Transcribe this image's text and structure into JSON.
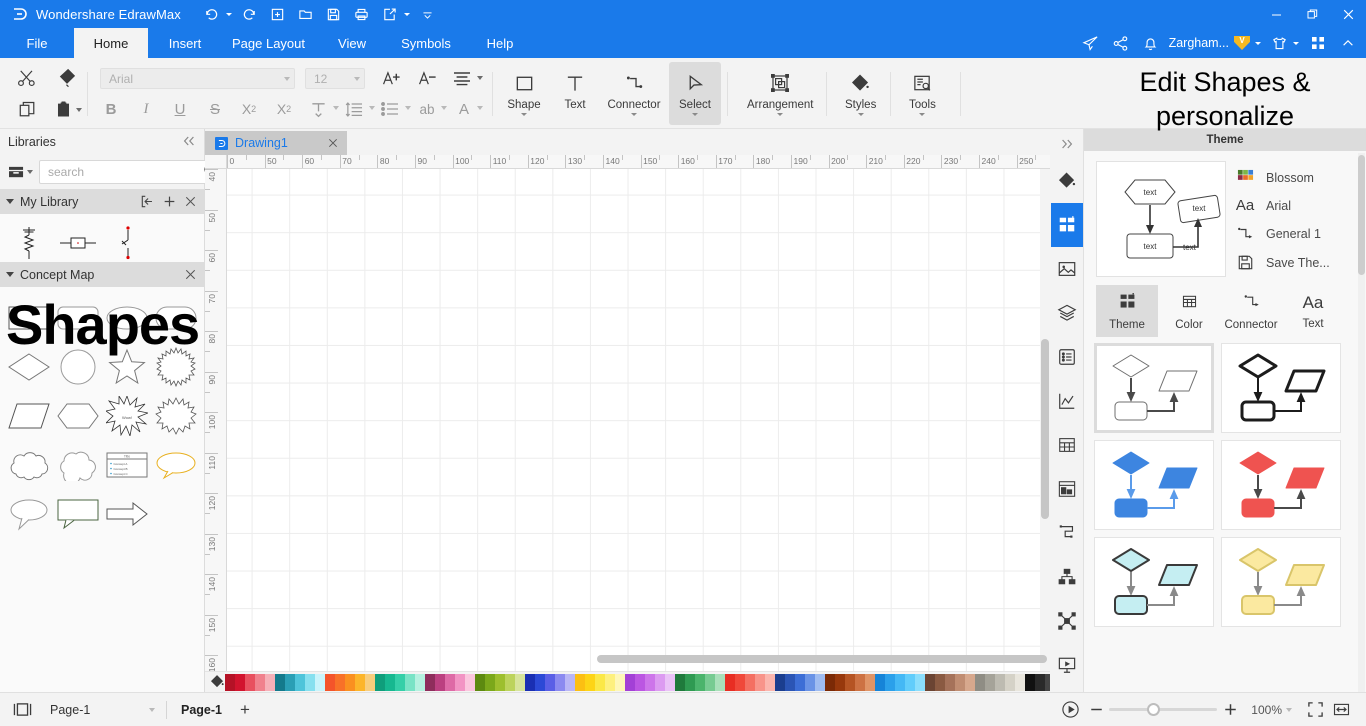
{
  "titlebar": {
    "app_name": "Wondershare EdrawMax",
    "logo_icon": "edraw-logo-icon",
    "quick_access": [
      {
        "name": "undo",
        "icon": "undo-icon",
        "has_caret": true
      },
      {
        "name": "redo",
        "icon": "redo-icon",
        "has_caret": false
      },
      {
        "name": "new",
        "icon": "new-file-icon",
        "has_caret": false
      },
      {
        "name": "open",
        "icon": "open-folder-icon",
        "has_caret": false
      },
      {
        "name": "save",
        "icon": "save-disk-icon",
        "has_caret": false
      },
      {
        "name": "print",
        "icon": "print-icon",
        "has_caret": false
      },
      {
        "name": "export",
        "icon": "export-share-icon",
        "has_caret": true
      },
      {
        "name": "customize",
        "icon": "chevron-down-icon",
        "has_caret": false
      }
    ],
    "window_controls": [
      {
        "name": "minimize",
        "glyph": "─"
      },
      {
        "name": "restore",
        "glyph": "❐"
      },
      {
        "name": "close",
        "glyph": "✕"
      }
    ]
  },
  "menubar": {
    "tabs": [
      {
        "label": "File",
        "active": false
      },
      {
        "label": "Home",
        "active": true
      },
      {
        "label": "Insert",
        "active": false
      },
      {
        "label": "Page Layout",
        "active": false
      },
      {
        "label": "View",
        "active": false
      },
      {
        "label": "Symbols",
        "active": false
      },
      {
        "label": "Help",
        "active": false
      }
    ],
    "right_icons": [
      {
        "name": "send-feedback-icon"
      },
      {
        "name": "share-icon"
      },
      {
        "name": "notifications-bell-icon"
      }
    ],
    "user": {
      "name": "Zargham...",
      "badge": "V"
    },
    "theme_switch_icon": "shirt-theme-icon",
    "apps_grid_icon": "apps-grid-icon",
    "collapse_ribbon_icon": "chevron-up-icon"
  },
  "ribbon": {
    "clipboard": [
      {
        "name": "cut",
        "icon": "scissors-icon",
        "disabled": false
      },
      {
        "name": "format-painter",
        "icon": "format-painter-icon",
        "disabled": false
      },
      {
        "name": "copy",
        "icon": "copy-icon",
        "disabled": false
      },
      {
        "name": "paste",
        "icon": "paste-icon",
        "disabled": false,
        "has_caret": true
      }
    ],
    "font_name": {
      "value": "Arial",
      "disabled": true
    },
    "font_size": {
      "value": "12",
      "disabled": true
    },
    "font_tools_row1": [
      {
        "name": "increase-font-size",
        "icon": "increase-font-icon"
      },
      {
        "name": "decrease-font-size",
        "icon": "decrease-font-icon"
      },
      {
        "name": "align-text",
        "icon": "align-icon",
        "has_caret": true
      }
    ],
    "font_tools_row2": [
      {
        "name": "bold",
        "icon": "bold-icon",
        "glyph": "B"
      },
      {
        "name": "italic",
        "icon": "italic-icon",
        "glyph": "I"
      },
      {
        "name": "underline",
        "icon": "underline-icon",
        "glyph": "U"
      },
      {
        "name": "strikethrough",
        "icon": "strikethrough-icon",
        "glyph": "S"
      },
      {
        "name": "superscript",
        "icon": "superscript-icon"
      },
      {
        "name": "subscript",
        "icon": "subscript-icon"
      },
      {
        "name": "text-position",
        "icon": "text-position-icon",
        "has_caret": true
      },
      {
        "name": "line-spacing",
        "icon": "line-spacing-icon",
        "has_caret": true
      },
      {
        "name": "bullet-list",
        "icon": "bullet-list-icon",
        "has_caret": true
      },
      {
        "name": "text-wrap",
        "icon": "text-wrap-icon",
        "glyph": "ab",
        "has_caret": true
      },
      {
        "name": "font-color",
        "icon": "font-color-icon",
        "glyph": "A",
        "has_caret": true
      }
    ],
    "big_buttons": [
      {
        "label": "Shape",
        "icon": "shape-square-icon",
        "has_caret": true,
        "active": false
      },
      {
        "label": "Text",
        "icon": "text-t-icon",
        "has_caret": false,
        "active": false
      },
      {
        "label": "Connector",
        "icon": "connector-icon",
        "has_caret": true,
        "active": false
      },
      {
        "label": "Select",
        "icon": "select-cursor-icon",
        "has_caret": true,
        "active": true
      },
      {
        "label": "Arrangement",
        "icon": "arrangement-icon",
        "has_caret": true,
        "active": false
      },
      {
        "label": "Styles",
        "icon": "fill-bucket-icon",
        "has_caret": true,
        "active": false
      },
      {
        "label": "Tools",
        "icon": "tools-inspect-icon",
        "has_caret": true,
        "active": false
      }
    ]
  },
  "libraries": {
    "title": "Libraries",
    "collapse_icon": "double-chevron-left-icon",
    "library_dropdown_icon": "library-box-icon",
    "search": {
      "placeholder": "search",
      "value": "",
      "icon": "search-icon"
    },
    "nav_up_icon": "chevron-up-icon",
    "nav_down_icon": "chevron-down-icon",
    "groups": [
      {
        "name": "My Library",
        "expanded": true,
        "actions": [
          {
            "name": "import-library",
            "icon": "import-icon"
          },
          {
            "name": "add-library",
            "icon": "plus-icon"
          },
          {
            "name": "close-library",
            "icon": "close-x-icon"
          }
        ],
        "shapes": [
          "resistor-symbol",
          "box-inline-symbol",
          "switch-symbol"
        ]
      },
      {
        "name": "Concept Map",
        "expanded": true,
        "actions": [
          {
            "name": "close-library",
            "icon": "close-x-icon"
          }
        ],
        "shapes": [
          "rectangle",
          "rounded-rectangle",
          "ellipse-flat",
          "stadium",
          "diamond",
          "circle",
          "star-5",
          "starburst-many",
          "parallelogram",
          "hexagon",
          "explosion-1",
          "explosion-2",
          "cloud-bumpy",
          "cloud-smooth",
          "list-card",
          "speech-oval",
          "speech-oval-tail",
          "speech-rect-tail",
          "block-arrow"
        ]
      }
    ],
    "overlay_text": "Shapes"
  },
  "canvas": {
    "tab": {
      "label": "Drawing1",
      "icon": "edraw-doc-icon",
      "close_icon": "close-x-icon"
    },
    "ruler_h_labels": [
      "0",
      "50",
      "60",
      "70",
      "80",
      "90",
      "100",
      "110",
      "120",
      "130",
      "140",
      "150",
      "160",
      "170",
      "180",
      "190",
      "200",
      "210",
      "220",
      "230",
      "240",
      "250"
    ],
    "ruler_v_labels": [
      "40",
      "50",
      "60",
      "70",
      "80",
      "90",
      "100",
      "110",
      "120",
      "130",
      "140",
      "150",
      "160"
    ],
    "vscroll_name": "canvas-vertical-scrollbar",
    "hscroll_name": "canvas-horizontal-scrollbar"
  },
  "palette": {
    "fill_icon": "fill-bucket-icon",
    "colors": [
      "#b51226",
      "#d2142e",
      "#e8505f",
      "#f0818d",
      "#f6b0b8",
      "#147a8c",
      "#2a9fb5",
      "#4ec4da",
      "#87e0ef",
      "#c9f4fb",
      "#f4542a",
      "#f87128",
      "#fa9020",
      "#fcb52a",
      "#f8cd7c",
      "#0f9e7b",
      "#17b890",
      "#35cfa8",
      "#79e3c6",
      "#b5f1e0",
      "#8e2d5c",
      "#bb4080",
      "#de6aa6",
      "#f294c4",
      "#fbc6de",
      "#5d8a10",
      "#7ba81b",
      "#9dbf2e",
      "#bcd35c",
      "#d7e49b",
      "#1a2fb3",
      "#2c49d6",
      "#5a5fe6",
      "#8b8af0",
      "#b9b6f6",
      "#fcbf12",
      "#fdd416",
      "#fbe847",
      "#fdf07e",
      "#fef7b8",
      "#a340d6",
      "#bb56e2",
      "#cd75ea",
      "#dc9bf1",
      "#eac2f7",
      "#1f7a3c",
      "#2f9a52",
      "#4bb46c",
      "#77cb92",
      "#a9e0ba",
      "#e82e23",
      "#f0483a",
      "#f46f62",
      "#f8948a",
      "#fbb5ad",
      "#1b3e8f",
      "#2b55b5",
      "#3d6ed6",
      "#6a93e6",
      "#9fbcf1",
      "#7b2a06",
      "#97380c",
      "#b55423",
      "#cd7243",
      "#e09466",
      "#1684d8",
      "#2ba0ea",
      "#44b8f5",
      "#62cdfb",
      "#8bdefc",
      "#6b4433",
      "#8a5a42",
      "#a5725a",
      "#c08d72",
      "#d7a88d",
      "#8f8d84",
      "#a5a399",
      "#bdbbb1",
      "#d5d2c7",
      "#e9e6dd",
      "#111111",
      "#2a2a2a",
      "#454545",
      "#636363",
      "#828282",
      "#a0a0a0",
      "#bdbdbd",
      "#d6d6d6",
      "#ededed",
      "#ffffff"
    ]
  },
  "rail": {
    "expand_icon": "double-chevron-right-icon",
    "items": [
      {
        "name": "styles-fill-icon",
        "active": false
      },
      {
        "name": "theme-grid-icon",
        "active": true
      },
      {
        "name": "image-icon",
        "active": false
      },
      {
        "name": "layers-icon",
        "active": false
      },
      {
        "name": "outline-list-icon",
        "active": false
      },
      {
        "name": "chart-icon",
        "active": false
      },
      {
        "name": "table-icon",
        "active": false
      },
      {
        "name": "container-icon",
        "active": false
      },
      {
        "name": "swimlane-icon",
        "active": false
      },
      {
        "name": "org-chart-icon",
        "active": false
      },
      {
        "name": "mind-map-icon",
        "active": false
      },
      {
        "name": "presentation-icon",
        "active": false
      }
    ]
  },
  "right_panel": {
    "overlay_text": "Edit Shapes & personalize",
    "header": "Theme",
    "preview_labels": {
      "node1": "text",
      "node2": "text",
      "node3": "text",
      "node4": "text"
    },
    "options": [
      {
        "label": "Blossom",
        "icon": "color-swatches-icon"
      },
      {
        "label": "Arial",
        "icon": "font-aa-icon"
      },
      {
        "label": "General 1",
        "icon": "connector-icon"
      },
      {
        "label": "Save The...",
        "icon": "save-disk-icon"
      }
    ],
    "tabs": [
      {
        "label": "Theme",
        "icon": "theme-grid-icon",
        "active": true
      },
      {
        "label": "Color",
        "icon": "color-table-icon",
        "active": false
      },
      {
        "label": "Connector",
        "icon": "connector-icon",
        "active": false
      },
      {
        "label": "Text",
        "icon": "font-aa-icon",
        "active": false
      }
    ],
    "thumbnails": [
      {
        "name": "theme-plain-light",
        "fill": "#ffffff",
        "stroke": "#6f6f6f",
        "stroke_width": 1,
        "arrow": "#4a4a4a",
        "selected": true
      },
      {
        "name": "theme-plain-bold",
        "fill": "#ffffff",
        "stroke": "#1c1c1c",
        "stroke_width": 3,
        "arrow": "#1c1c1c",
        "selected": false
      },
      {
        "name": "theme-blue",
        "fill": "#3d85e0",
        "stroke": "#3d85e0",
        "stroke_width": 0,
        "arrow": "#5a9bea",
        "selected": false
      },
      {
        "name": "theme-red",
        "fill": "#ef5350",
        "stroke": "#ef5350",
        "stroke_width": 0,
        "arrow": "#4a4a4a",
        "selected": false
      },
      {
        "name": "theme-cyan",
        "fill": "#c5eef2",
        "stroke": "#3a3a3a",
        "stroke_width": 2,
        "arrow": "#8a8a8a",
        "selected": false
      },
      {
        "name": "theme-yellow",
        "fill": "#fbe9a0",
        "stroke": "#d9c56a",
        "stroke_width": 2,
        "arrow": "#8a8a8a",
        "selected": false
      }
    ]
  },
  "statusbar": {
    "view_mode_icon": "page-view-icon",
    "page_selector": {
      "value": "Page-1",
      "caret_icon": "chevron-down-icon"
    },
    "page_tab": "Page-1",
    "add_page_icon": "plus-icon",
    "presentation_icon": "play-circle-icon",
    "zoom_out_icon": "minus-icon",
    "zoom_in_icon": "plus-icon",
    "zoom_level": "100%",
    "zoom_caret_icon": "chevron-down-icon",
    "fit_page_icon": "fit-page-icon",
    "fit_width_icon": "fit-width-icon"
  }
}
